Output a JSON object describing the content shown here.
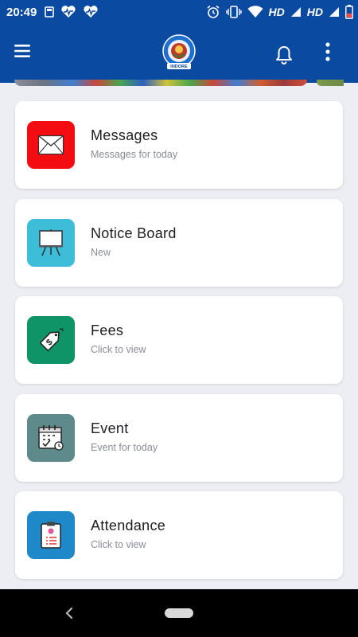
{
  "status_bar": {
    "time": "20:49",
    "network_label_1": "HD",
    "network_label_2": "HD"
  },
  "app_bar": {
    "logo_text": "INDORE"
  },
  "cards": [
    {
      "title": "Messages",
      "subtitle": "Messages for today",
      "icon": "envelope-icon",
      "color": "#f30d13"
    },
    {
      "title": "Notice Board",
      "subtitle": "New",
      "icon": "easel-icon",
      "color": "#3dbdd8"
    },
    {
      "title": "Fees",
      "subtitle": "Click to view",
      "icon": "price-tag-icon",
      "color": "#0f9468"
    },
    {
      "title": "Event",
      "subtitle": "Event for today",
      "icon": "calendar-icon",
      "color": "#5f8a8b"
    },
    {
      "title": "Attendance",
      "subtitle": "Click to view",
      "icon": "clipboard-icon",
      "color": "#1f88c8"
    }
  ]
}
